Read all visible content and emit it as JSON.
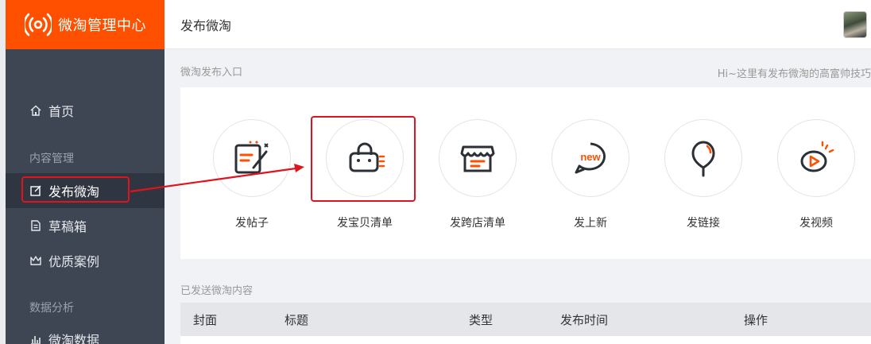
{
  "app": {
    "title": "微淘管理中心",
    "brand_color": "#ff5000"
  },
  "sidebar": {
    "home": "首页",
    "group_content": "内容管理",
    "items": [
      "发布微淘",
      "草稿箱",
      "优质案例"
    ],
    "group_data": "数据分析",
    "data_item": "微淘数据"
  },
  "topbar": {
    "title": "发布微淘"
  },
  "publish": {
    "section_label": "微淘发布入口",
    "hint": "Hi~这里有发布微淘的高富帅技巧",
    "entries": [
      "发帖子",
      "发宝贝清单",
      "发跨店清单",
      "发上新",
      "发链接",
      "发视频"
    ],
    "new_badge": "new"
  },
  "sent": {
    "section_label": "已发送微淘内容",
    "columns": [
      "封面",
      "标题",
      "类型",
      "发布时间",
      "操作"
    ]
  },
  "colors": {
    "accent": "#ff5000",
    "sidebar_bg": "#3e4654",
    "highlight": "#e0141e"
  }
}
